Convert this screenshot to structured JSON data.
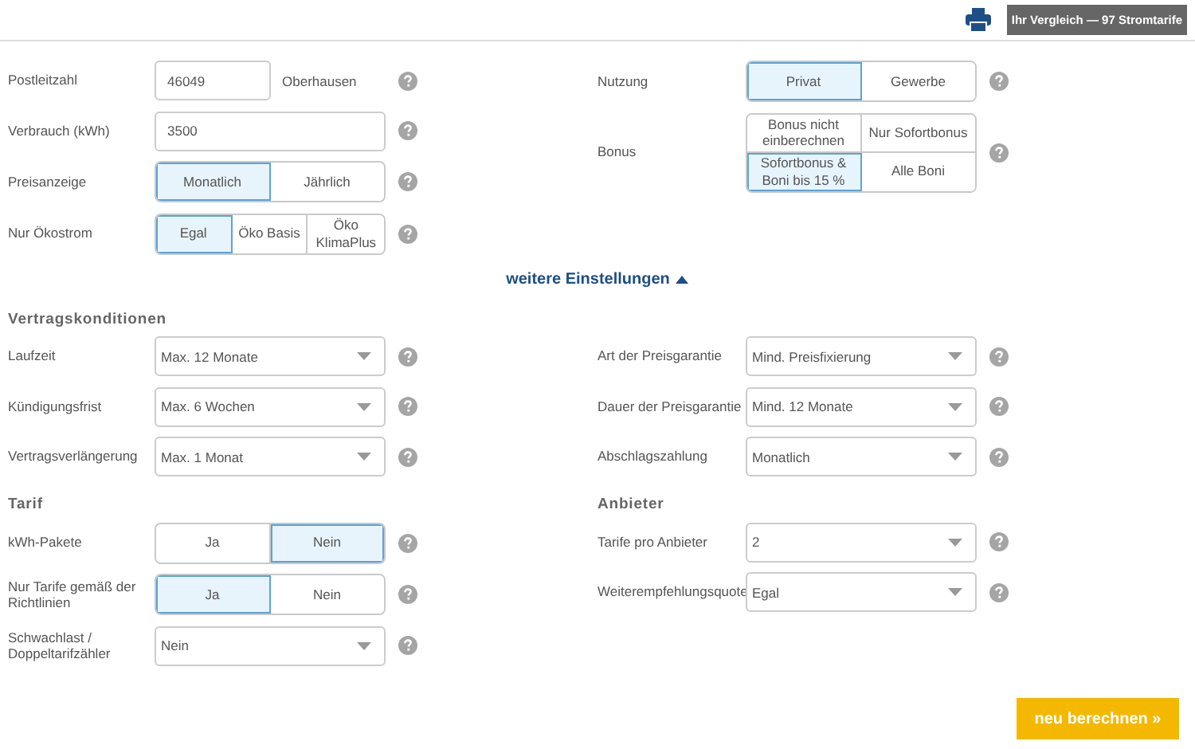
{
  "header": {
    "summary": "Ihr Vergleich — 97 Stromtarife"
  },
  "basic": {
    "left": [
      {
        "kind": "input",
        "label": "Postleitzahl",
        "value": "46049",
        "extra": "Oberhausen"
      },
      {
        "kind": "input",
        "label": "Verbrauch (kWh)",
        "value": "3500"
      },
      {
        "kind": "options",
        "label": "Preisanzeige",
        "options": [
          {
            "label": "Monatlich",
            "selected": true
          },
          {
            "label": "Jährlich",
            "selected": false
          }
        ]
      },
      {
        "kind": "options",
        "label": "Nur Ökostrom",
        "options": [
          {
            "label": "Egal",
            "selected": true
          },
          {
            "label": "Öko Basis",
            "selected": false
          },
          {
            "label": "Öko KlimaPlus",
            "selected": false
          }
        ]
      }
    ],
    "right": [
      {
        "kind": "options",
        "label": "Nutzung",
        "options": [
          {
            "label": "Privat",
            "selected": true
          },
          {
            "label": "Gewerbe",
            "selected": false
          }
        ]
      },
      {
        "kind": "options",
        "label": "Bonus",
        "options": [
          {
            "label": "Bonus nicht einberechnen",
            "selected": false
          },
          {
            "label": "Nur Sofortbonus",
            "selected": false
          },
          {
            "label": "Sofortbonus & Boni bis 15 %",
            "selected": true
          },
          {
            "label": "Alle Boni",
            "selected": false
          }
        ]
      }
    ]
  },
  "more_settings": {
    "label": "weitere Einstellungen",
    "expanded": true
  },
  "sections": [
    {
      "left": {
        "title": "Vertragskonditionen",
        "rows": [
          {
            "kind": "select",
            "label": "Laufzeit",
            "value": "Max. 12 Monate"
          },
          {
            "kind": "select",
            "label": "Kündigungsfrist",
            "value": "Max. 6 Wochen"
          },
          {
            "kind": "select",
            "label": "Vertragsverlängerung",
            "value": "Max. 1 Monat"
          }
        ]
      },
      "right": {
        "rows": [
          {
            "kind": "select",
            "label": "Art der Preisgarantie",
            "value": "Mind. Preisfixierung"
          },
          {
            "kind": "select",
            "label": "Dauer der Preisgarantie",
            "value": "Mind. 12 Monate"
          },
          {
            "kind": "select",
            "label": "Abschlagszahlung",
            "value": "Monatlich"
          }
        ]
      }
    },
    {
      "left": {
        "title": "Tarif",
        "rows": [
          {
            "kind": "options",
            "label": "kWh-Pakete",
            "options": [
              {
                "label": "Ja",
                "selected": false
              },
              {
                "label": "Nein",
                "selected": true
              }
            ]
          },
          {
            "kind": "options",
            "label": "Nur Tarife gemäß der Richtlinien",
            "options": [
              {
                "label": "Ja",
                "selected": true
              },
              {
                "label": "Nein",
                "selected": false
              }
            ]
          },
          {
            "kind": "select",
            "label": "Schwachlast / Doppeltarifzähler",
            "value": "Nein"
          }
        ]
      },
      "right": {
        "title": "Anbieter",
        "rows": [
          {
            "kind": "select",
            "label": "Tarife pro Anbieter",
            "value": "2"
          },
          {
            "kind": "select",
            "label": "Weiterempfehlungsquote",
            "value": "Egal"
          }
        ]
      }
    }
  ],
  "submit": "neu berechnen »"
}
